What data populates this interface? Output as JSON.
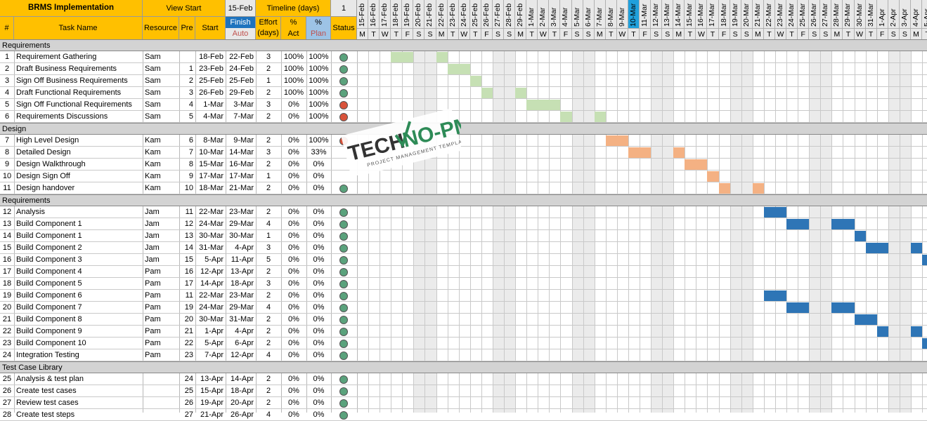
{
  "header": {
    "title": "BRMS Implementation",
    "view_start_label": "View Start",
    "view_start_value": "15-Feb",
    "timeline_label": "Timeline (days)",
    "timeline_value": "1",
    "finish_label": "Finish",
    "auto_label": "Auto",
    "col_num": "#",
    "col_task": "Task Name",
    "col_resource": "Resource",
    "col_pre": "Pre",
    "col_start": "Start",
    "col_effort": "Effort (days)",
    "col_pct_act_top": "%",
    "col_pct_act_bottom": "Act",
    "col_pct_plan_top": "%",
    "col_pct_plan_bottom": "Plan",
    "col_status": "Status"
  },
  "dates": [
    "15-Feb",
    "16-Feb",
    "17-Feb",
    "18-Feb",
    "19-Feb",
    "20-Feb",
    "21-Feb",
    "22-Feb",
    "23-Feb",
    "24-Feb",
    "25-Feb",
    "26-Feb",
    "27-Feb",
    "28-Feb",
    "29-Feb",
    "1-Mar",
    "2-Mar",
    "3-Mar",
    "4-Mar",
    "5-Mar",
    "6-Mar",
    "7-Mar",
    "8-Mar",
    "9-Mar",
    "10-Mar",
    "11-Mar",
    "12-Mar",
    "13-Mar",
    "14-Mar",
    "15-Mar",
    "16-Mar",
    "17-Mar",
    "18-Mar",
    "19-Mar",
    "20-Mar",
    "21-Mar",
    "22-Mar",
    "23-Mar",
    "24-Mar",
    "25-Mar",
    "26-Mar",
    "27-Mar",
    "28-Mar",
    "29-Mar",
    "30-Mar",
    "31-Mar",
    "1-Apr",
    "2-Apr",
    "3-Apr",
    "4-Apr",
    "5-Apr"
  ],
  "weekdays": [
    "M",
    "T",
    "W",
    "T",
    "F",
    "S",
    "S",
    "M",
    "T",
    "W",
    "T",
    "F",
    "S",
    "S",
    "M",
    "T",
    "W",
    "T",
    "F",
    "S",
    "S",
    "M",
    "T",
    "W",
    "T",
    "F",
    "S",
    "S",
    "M",
    "T",
    "W",
    "T",
    "F",
    "S",
    "S",
    "M",
    "T",
    "W",
    "T",
    "F",
    "S",
    "S",
    "M",
    "T",
    "W",
    "T",
    "F",
    "S",
    "S",
    "M",
    "T"
  ],
  "today_index": 24,
  "colors": {
    "green": "#c6e0b4",
    "orange": "#f4b183",
    "blue": "#2e75b6",
    "dot_green": "#5aa27c",
    "dot_red": "#d9533b"
  },
  "rows": [
    {
      "section": "Requirements"
    },
    {
      "n": "1",
      "task": "Requirement Gathering",
      "res": "Sam",
      "pre": "",
      "start": "18-Feb",
      "finish": "22-Feb",
      "effort": "3",
      "act": "100%",
      "plan": "100%",
      "status": "green",
      "color": "green",
      "bar": [
        [
          3,
          4
        ],
        [
          7,
          7
        ]
      ]
    },
    {
      "n": "2",
      "task": "Draft Business Requirements",
      "res": "Sam",
      "pre": "1",
      "start": "23-Feb",
      "finish": "24-Feb",
      "effort": "2",
      "act": "100%",
      "plan": "100%",
      "status": "green",
      "color": "green",
      "bar": [
        [
          8,
          9
        ]
      ]
    },
    {
      "n": "3",
      "task": "Sign Off Business Requirements",
      "res": "Sam",
      "pre": "2",
      "start": "25-Feb",
      "finish": "25-Feb",
      "effort": "1",
      "act": "100%",
      "plan": "100%",
      "status": "green",
      "color": "green",
      "bar": [
        [
          10,
          10
        ]
      ]
    },
    {
      "n": "4",
      "task": "Draft Functional Requirements",
      "res": "Sam",
      "pre": "3",
      "start": "26-Feb",
      "finish": "29-Feb",
      "effort": "2",
      "act": "100%",
      "plan": "100%",
      "status": "green",
      "color": "green",
      "bar": [
        [
          11,
          11
        ],
        [
          14,
          14
        ]
      ]
    },
    {
      "n": "5",
      "task": "Sign Off Functional Requirements",
      "res": "Sam",
      "pre": "4",
      "start": "1-Mar",
      "finish": "3-Mar",
      "effort": "3",
      "act": "0%",
      "plan": "100%",
      "status": "red",
      "color": "green",
      "bar": [
        [
          15,
          17
        ]
      ]
    },
    {
      "n": "6",
      "task": "Requirements Discussions",
      "res": "Sam",
      "pre": "5",
      "start": "4-Mar",
      "finish": "7-Mar",
      "effort": "2",
      "act": "0%",
      "plan": "100%",
      "status": "red",
      "color": "green",
      "bar": [
        [
          18,
          18
        ],
        [
          21,
          21
        ]
      ]
    },
    {
      "section": "Design"
    },
    {
      "n": "7",
      "task": "High Level Design",
      "res": "Kam",
      "pre": "6",
      "start": "8-Mar",
      "finish": "9-Mar",
      "effort": "2",
      "act": "0%",
      "plan": "100%",
      "status": "red",
      "color": "orange",
      "bar": [
        [
          22,
          23
        ]
      ]
    },
    {
      "n": "8",
      "task": "Detailed Design",
      "res": "Kam",
      "pre": "7",
      "start": "10-Mar",
      "finish": "14-Mar",
      "effort": "3",
      "act": "0%",
      "plan": "33%",
      "status": "none",
      "color": "orange",
      "bar": [
        [
          24,
          25
        ],
        [
          28,
          28
        ]
      ]
    },
    {
      "n": "9",
      "task": "Design Walkthrough",
      "res": "Kam",
      "pre": "8",
      "start": "15-Mar",
      "finish": "16-Mar",
      "effort": "2",
      "act": "0%",
      "plan": "0%",
      "status": "none",
      "color": "orange",
      "bar": [
        [
          29,
          30
        ]
      ]
    },
    {
      "n": "10",
      "task": "Design Sign Off",
      "res": "Kam",
      "pre": "9",
      "start": "17-Mar",
      "finish": "17-Mar",
      "effort": "1",
      "act": "0%",
      "plan": "0%",
      "status": "none",
      "color": "orange",
      "bar": [
        [
          31,
          31
        ]
      ]
    },
    {
      "n": "11",
      "task": "Design handover",
      "res": "Kam",
      "pre": "10",
      "start": "18-Mar",
      "finish": "21-Mar",
      "effort": "2",
      "act": "0%",
      "plan": "0%",
      "status": "green",
      "color": "orange",
      "bar": [
        [
          32,
          32
        ],
        [
          35,
          35
        ]
      ]
    },
    {
      "section": "Requirements"
    },
    {
      "n": "12",
      "task": "Analysis",
      "res": "Jam",
      "pre": "11",
      "start": "22-Mar",
      "finish": "23-Mar",
      "effort": "2",
      "act": "0%",
      "plan": "0%",
      "status": "green",
      "color": "blue",
      "bar": [
        [
          36,
          37
        ]
      ]
    },
    {
      "n": "13",
      "task": "Build Component 1",
      "res": "Jam",
      "pre": "12",
      "start": "24-Mar",
      "finish": "29-Mar",
      "effort": "4",
      "act": "0%",
      "plan": "0%",
      "status": "green",
      "color": "blue",
      "bar": [
        [
          38,
          39
        ],
        [
          42,
          43
        ]
      ]
    },
    {
      "n": "14",
      "task": "Build Component 1",
      "res": "Jam",
      "pre": "13",
      "start": "30-Mar",
      "finish": "30-Mar",
      "effort": "1",
      "act": "0%",
      "plan": "0%",
      "status": "green",
      "color": "blue",
      "bar": [
        [
          44,
          44
        ]
      ]
    },
    {
      "n": "15",
      "task": "Build Component 2",
      "res": "Jam",
      "pre": "14",
      "start": "31-Mar",
      "finish": "4-Apr",
      "effort": "3",
      "act": "0%",
      "plan": "0%",
      "status": "green",
      "color": "blue",
      "bar": [
        [
          45,
          46
        ],
        [
          49,
          49
        ]
      ]
    },
    {
      "n": "16",
      "task": "Build Component 3",
      "res": "Jam",
      "pre": "15",
      "start": "5-Apr",
      "finish": "11-Apr",
      "effort": "5",
      "act": "0%",
      "plan": "0%",
      "status": "green",
      "color": "blue",
      "bar": [
        [
          50,
          50
        ]
      ]
    },
    {
      "n": "17",
      "task": "Build Component 4",
      "res": "Pam",
      "pre": "16",
      "start": "12-Apr",
      "finish": "13-Apr",
      "effort": "2",
      "act": "0%",
      "plan": "0%",
      "status": "green",
      "color": "blue",
      "bar": []
    },
    {
      "n": "18",
      "task": "Build Component 5",
      "res": "Pam",
      "pre": "17",
      "start": "14-Apr",
      "finish": "18-Apr",
      "effort": "3",
      "act": "0%",
      "plan": "0%",
      "status": "green",
      "color": "blue",
      "bar": []
    },
    {
      "n": "19",
      "task": "Build Component 6",
      "res": "Pam",
      "pre": "11",
      "start": "22-Mar",
      "finish": "23-Mar",
      "effort": "2",
      "act": "0%",
      "plan": "0%",
      "status": "green",
      "color": "blue",
      "bar": [
        [
          36,
          37
        ]
      ]
    },
    {
      "n": "20",
      "task": "Build Component 7",
      "res": "Pam",
      "pre": "19",
      "start": "24-Mar",
      "finish": "29-Mar",
      "effort": "4",
      "act": "0%",
      "plan": "0%",
      "status": "green",
      "color": "blue",
      "bar": [
        [
          38,
          39
        ],
        [
          42,
          43
        ]
      ]
    },
    {
      "n": "21",
      "task": "Build Component 8",
      "res": "Pam",
      "pre": "20",
      "start": "30-Mar",
      "finish": "31-Mar",
      "effort": "2",
      "act": "0%",
      "plan": "0%",
      "status": "green",
      "color": "blue",
      "bar": [
        [
          44,
          45
        ]
      ]
    },
    {
      "n": "22",
      "task": "Build Component 9",
      "res": "Pam",
      "pre": "21",
      "start": "1-Apr",
      "finish": "4-Apr",
      "effort": "2",
      "act": "0%",
      "plan": "0%",
      "status": "green",
      "color": "blue",
      "bar": [
        [
          46,
          46
        ],
        [
          49,
          49
        ]
      ]
    },
    {
      "n": "23",
      "task": "Build Component 10",
      "res": "Pam",
      "pre": "22",
      "start": "5-Apr",
      "finish": "6-Apr",
      "effort": "2",
      "act": "0%",
      "plan": "0%",
      "status": "green",
      "color": "blue",
      "bar": [
        [
          50,
          50
        ]
      ]
    },
    {
      "n": "24",
      "task": "Integration Testing",
      "res": "Pam",
      "pre": "23",
      "start": "7-Apr",
      "finish": "12-Apr",
      "effort": "4",
      "act": "0%",
      "plan": "0%",
      "status": "green",
      "color": "blue",
      "bar": []
    },
    {
      "section": "Test Case Library"
    },
    {
      "n": "25",
      "task": "Analysis & test plan",
      "res": "",
      "pre": "24",
      "start": "13-Apr",
      "finish": "14-Apr",
      "effort": "2",
      "act": "0%",
      "plan": "0%",
      "status": "green",
      "color": "blue",
      "bar": []
    },
    {
      "n": "26",
      "task": "Create test cases",
      "res": "",
      "pre": "25",
      "start": "15-Apr",
      "finish": "18-Apr",
      "effort": "2",
      "act": "0%",
      "plan": "0%",
      "status": "green",
      "color": "blue",
      "bar": []
    },
    {
      "n": "27",
      "task": "Review test cases",
      "res": "",
      "pre": "26",
      "start": "19-Apr",
      "finish": "20-Apr",
      "effort": "2",
      "act": "0%",
      "plan": "0%",
      "status": "green",
      "color": "blue",
      "bar": []
    },
    {
      "n": "28",
      "task": "Create test steps",
      "res": "",
      "pre": "27",
      "start": "21-Apr",
      "finish": "26-Apr",
      "effort": "4",
      "act": "0%",
      "plan": "0%",
      "status": "green",
      "color": "blue",
      "bar": []
    }
  ],
  "logo": {
    "main_left": "TECH",
    "main_right": "NO-PM",
    "tagline": "PROJECT MANAGEMENT TEMPLATES"
  }
}
